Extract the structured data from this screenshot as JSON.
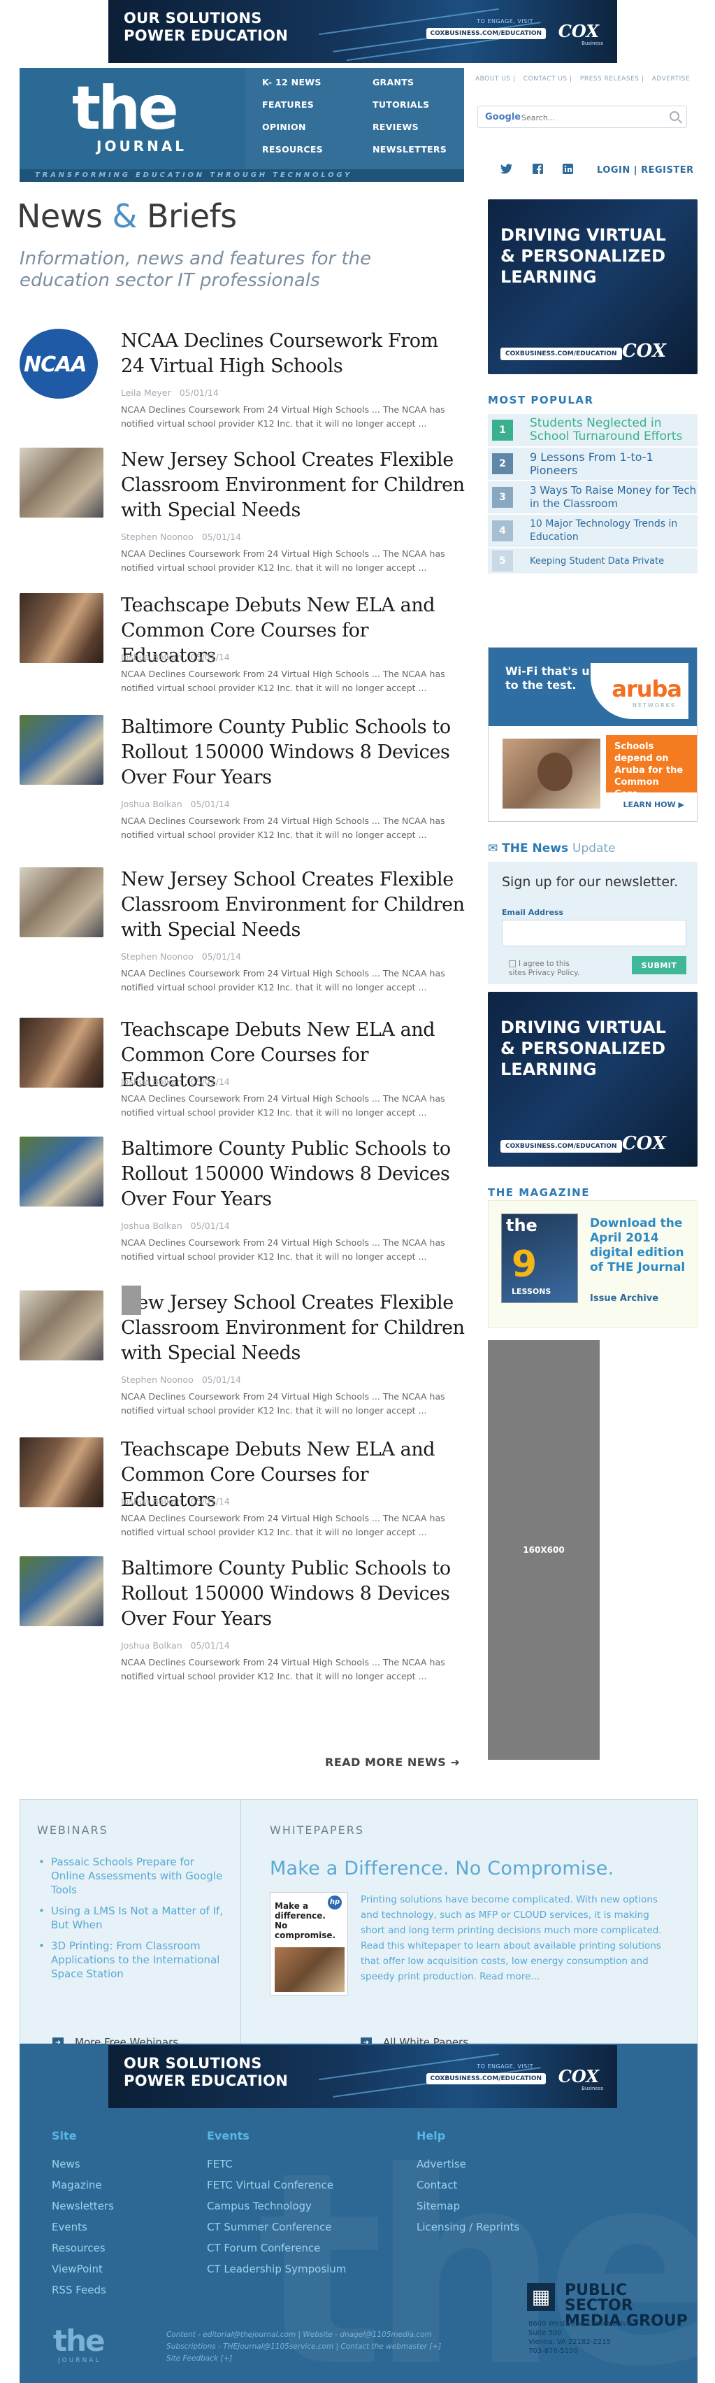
{
  "top_banner": {
    "title_line1": "OUR SOLUTIONS",
    "title_line2": "POWER EDUCATION",
    "engage": "TO ENGAGE, VISIT",
    "url": "COXBUSINESS.COM/EDUCATION",
    "brand": "COX",
    "brand_sub": "Business"
  },
  "header": {
    "logo_the": "the",
    "logo_journal": "JOURNAL",
    "tagline": "TRANSFORMING EDUCATION THROUGH TECHNOLOGY",
    "nav_col1": [
      "K- 12 NEWS",
      "FEATURES",
      "OPINION",
      "RESOURCES"
    ],
    "nav_col2": [
      "GRANTS",
      "TUTORIALS",
      "REVIEWS",
      "NEWSLETTERS"
    ],
    "top_links": [
      "ABOUT US",
      "CONTACT US",
      "PRESS RELEASES",
      "ADVERTISE"
    ],
    "search_placeholder": "Search...",
    "search_google": "Google",
    "login": "LOGIN",
    "register": "REGISTER",
    "login_sep": "|"
  },
  "page": {
    "title_news": "News",
    "title_amp": "&",
    "title_briefs": "Briefs",
    "subtitle": "Information, news and features for the education sector IT professionals"
  },
  "articles": [
    {
      "title": "NCAA Declines Coursework From 24 Virtual High Schools",
      "author": "Leila Meyer",
      "date": "05/01/14",
      "blurb": "NCAA Declines Coursework From 24 Virtual High Schools ... The NCAA has notified virtual school provider K12 Inc. that it will no longer accept ...",
      "thumb": "ncaa-logo",
      "logo_text": "NCAA"
    },
    {
      "title": "New Jersey School Creates Flexible Classroom Environment for Children with Special Needs",
      "author": "Stephen Noonoo",
      "date": "05/01/14",
      "blurb": "NCAA Declines Coursework From 24 Virtual High Schools ... The NCAA has notified virtual school provider K12 Inc. that it will no longer accept ...",
      "thumb": "classroom-photo"
    },
    {
      "title": "Teachscape Debuts New ELA and Common Core Courses for Educators",
      "author": "Joshua Bolkan",
      "date": "05/01/14",
      "blurb": "NCAA Declines Coursework From 24 Virtual High Schools ... The NCAA has notified virtual school provider K12 Inc. that it will no longer accept ...",
      "thumb": "educators-photo"
    },
    {
      "title": "Baltimore County Public Schools to Rollout 150000 Windows 8 Devices Over Four Years",
      "author": "Joshua Bolkan",
      "date": "05/01/14",
      "blurb": "NCAA Declines Coursework From 24 Virtual High Schools ... The NCAA has notified virtual school provider K12 Inc. that it will no longer accept ...",
      "thumb": "student-computer-photo"
    },
    {
      "title": "New Jersey School Creates Flexible Classroom Environment for Children with Special Needs",
      "author": "Stephen Noonoo",
      "date": "05/01/14",
      "blurb": "NCAA Declines Coursework From 24 Virtual High Schools ... The NCAA has notified virtual school provider K12 Inc. that it will no longer accept ...",
      "thumb": "classroom-photo"
    },
    {
      "title": "Teachscape Debuts New ELA and Common Core Courses for Educators",
      "author": "Joshua Bolkan",
      "date": "05/01/14",
      "blurb": "NCAA Declines Coursework From 24 Virtual High Schools ... The NCAA has notified virtual school provider K12 Inc. that it will no longer accept ...",
      "thumb": "educators-photo"
    },
    {
      "title": "Baltimore County Public Schools to Rollout 150000 Windows 8 Devices Over Four Years",
      "author": "Joshua Bolkan",
      "date": "05/01/14",
      "blurb": "NCAA Declines Coursework From 24 Virtual High Schools ... The NCAA has notified virtual school provider K12 Inc. that it will no longer accept ...",
      "thumb": "student-computer-photo"
    },
    {
      "title": "New Jersey School Creates Flexible Classroom Environment for Children with Special Needs",
      "author": "Stephen Noonoo",
      "date": "05/01/14",
      "blurb": "NCAA Declines Coursework From 24 Virtual High Schools ... The NCAA has notified virtual school provider K12 Inc. that it will no longer accept ...",
      "thumb": "classroom-photo"
    },
    {
      "title": "Teachscape Debuts New ELA and Common Core Courses for Educators",
      "author": "Joshua Bolkan",
      "date": "05/01/14",
      "blurb": "NCAA Declines Coursework From 24 Virtual High Schools ... The NCAA has notified virtual school provider K12 Inc. that it will no longer accept ...",
      "thumb": "educators-photo"
    },
    {
      "title": "Baltimore County Public Schools to Rollout 150000 Windows 8 Devices Over Four Years",
      "author": "Joshua Bolkan",
      "date": "05/01/14",
      "blurb": "NCAA Declines Coursework From 24 Virtual High Schools ... The NCAA has notified virtual school provider K12 Inc. that it will no longer accept ...",
      "thumb": "student-computer-photo"
    }
  ],
  "read_more": "READ MORE NEWS",
  "sidebar": {
    "ad_title_l1": "DRIVING VIRTUAL",
    "ad_title_l2": "& PERSONALIZED",
    "ad_title_l3": "LEARNING",
    "ad_url": "COXBUSINESS.COM/EDUCATION",
    "ad_brand": "COX",
    "most_popular_head": "MOST POPULAR",
    "most_popular": [
      {
        "num": "1",
        "label": "Students Neglected in School Turnaround Efforts",
        "color": "#3bb08f"
      },
      {
        "num": "2",
        "label": "9 Lessons From 1-to-1 Pioneers",
        "color": "#5f87a8"
      },
      {
        "num": "3",
        "label": "3 Ways To Raise Money for Tech in the Classroom",
        "color": "#5f87a8"
      },
      {
        "num": "4",
        "label": "10 Major Technology Trends in Education",
        "color": "#a7bfd2"
      },
      {
        "num": "5",
        "label": "Keeping Student Data Private",
        "color": "#c9d9e5"
      }
    ],
    "aruba_title_l1": "Wi-Fi that's up",
    "aruba_title_l2": "to the test.",
    "aruba_brand": "aruba",
    "aruba_networks": "NETWORKS",
    "aruba_orange": "Schools depend on Aruba for the Common Core.",
    "aruba_learn": "LEARN HOW",
    "news_update_the": "THE News",
    "news_update_upd": "Update",
    "nl_head": "Sign up for our newsletter.",
    "nl_label": "Email Address",
    "nl_agree_l1": "I agree to this",
    "nl_agree_l2": "sites Privacy Policy.",
    "nl_submit": "SUBMIT",
    "magazine_head": "THE MAGAZINE",
    "mag_cover_the": "the",
    "mag_cover_nine": "9",
    "mag_cover_lessons": "LESSONS",
    "mag_link": "Download the April 2014 digital edition of THE Journal",
    "mag_archive": "Issue Archive",
    "placeholder": "160X600"
  },
  "webinars": {
    "head": "WEBINARS",
    "items": [
      "Passaic Schools Prepare for Online Assessments with Google Tools",
      "Using a LMS Is Not a Matter of If, But When",
      "3D Printing: From Classroom Applications to the International Space Station"
    ],
    "more": "More Free Webinars..."
  },
  "whitepapers": {
    "head": "WHITEPAPERS",
    "title": "Make a Difference. No Compromise.",
    "img_text": "Make a difference. No compromise.",
    "img_brand": "hp",
    "text": "Printing solutions have become complicated. With new options and technology, such as MFP or CLOUD services, it is making short and long term printing decisions much more complicated. Read this whitepaper to learn about available printing solutions that offer low acquisition costs, low energy consumption and speedy print production. Read more...",
    "more": "All White Papers"
  },
  "footer_banner": {
    "title_line1": "OUR SOLUTIONS",
    "title_line2": "POWER EDUCATION",
    "engage": "TO ENGAGE, VISIT",
    "url": "COXBUSINESS.COM/EDUCATION",
    "brand": "COX",
    "brand_sub": "Business"
  },
  "footer": {
    "site_head": "Site",
    "site": [
      "News",
      "Magazine",
      "Newsletters",
      "Events",
      "Resources",
      "ViewPoint",
      "RSS Feeds"
    ],
    "events_head": "Events",
    "events": [
      "FETC",
      "FETC Virtual Conference",
      "Campus Technology",
      "CT Summer Conference",
      "CT Forum Conference",
      "CT Leadership Symposium"
    ],
    "help_head": "Help",
    "help": [
      "Advertise",
      "Contact",
      "Sitemap",
      "Licensing / Reprints"
    ],
    "ps_line1": "PUBLIC SECTOR",
    "ps_line2": "MEDIA GROUP",
    "ps_addr1": "8609 Westwood Center Drive",
    "ps_addr2": "Suite 500",
    "ps_addr3": "Vienna, VA 22182-2215",
    "ps_addr4": "703-876-5100",
    "logo_the": "the",
    "logo_journal": "JOURNAL",
    "links_l1": "Content - editorial@thejournal.com  |  Website - dnagel@1105media.com",
    "links_l2": "Subscriptions - THEJournal@1105service.com  |  Contact the webmaster [+]",
    "links_l3": "Site Feedback [+]"
  }
}
